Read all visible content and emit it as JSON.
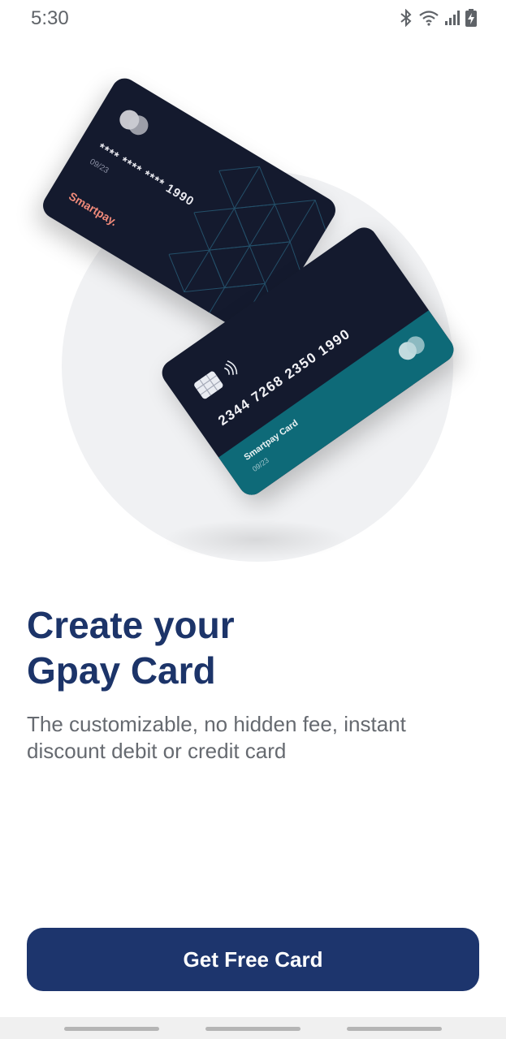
{
  "status_bar": {
    "time": "5:30",
    "icons": [
      "bluetooth-icon",
      "wifi-icon",
      "signal-icon",
      "battery-charging-icon"
    ]
  },
  "hero": {
    "back_card": {
      "masked_number": "**** **** **** 1990",
      "expiry": "09/23",
      "brand": "Smartpay."
    },
    "front_card": {
      "number": "2344 7268 2350 1990",
      "name": "Smartpay Card",
      "expiry": "09/23"
    }
  },
  "content": {
    "headline_line1": "Create your",
    "headline_line2": "Gpay Card",
    "subtext_line1": "The customizable, no hidden fee, instant",
    "subtext_line2": "discount debit or credit card"
  },
  "cta": {
    "label": "Get Free Card"
  },
  "colors": {
    "primary": "#1d356d",
    "headline": "#1c3469",
    "card_dark": "#141a2e",
    "card_teal": "#0e6a78",
    "brand_accent": "#f08a7a"
  }
}
